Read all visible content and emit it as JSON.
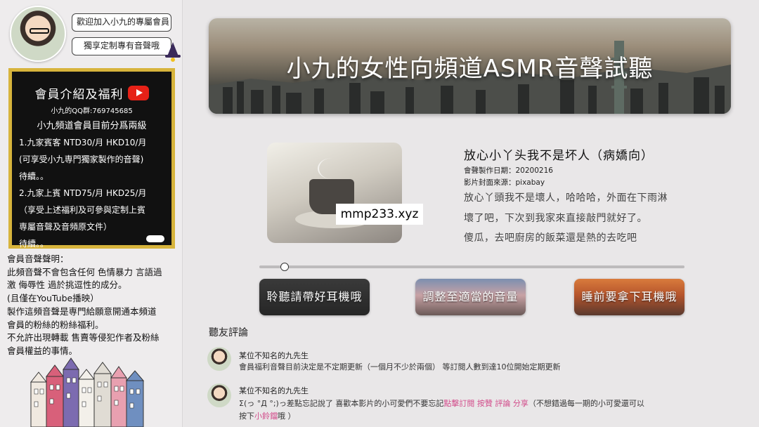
{
  "sidebar": {
    "welcome_label": "歡迎加入小九的專屬會員",
    "custom_label": "獨享定制專有音聲哦",
    "card": {
      "title": "會員介紹及福利",
      "qq": "小九的QQ群:769745685",
      "levels": "小九頻道會員目前分爲兩級",
      "lines": [
        "1.九家賓客 NTD30/月 HKD10/月",
        "(可享受小九専門獨家製作的音聲)",
        "待續。。",
        "2.九家上賓 NTD75/月 HKD25/月",
        "（享受上述福利及可參與定制上賓",
        "専屬音聲及音頻原文件）",
        "待續。。"
      ]
    },
    "notice": [
      "會員音聲聲明：",
      "此頻音聲不會包含任何 色情暴力 言語過",
      "激 侮辱性 過於挑逗性的成分。",
      "(且僅在YouTube播映）",
      "製作這頻音聲是専門給願意開通本頻道",
      "會員的粉絲的粉絲福利。",
      "不允許出現轉載 售賣等侵犯作者及粉絲",
      "會員權益的事情。"
    ]
  },
  "banner": {
    "title": "小九的女性向頻道ASMR音聲試聽"
  },
  "track": {
    "title": "放心小丫头我不是坏人（病嬌向）",
    "date": "會聲製作日期：20200216",
    "source": "影片封面來源：pixabay",
    "desc": [
      "放心丫頭我不是壞人，哈哈哈，外面在下雨淋",
      "壞了吧，下次到我家來直接敲門就好了。",
      "傻瓜，去吧廚房的飯菜還是熱的去吃吧"
    ],
    "progress": 0.06
  },
  "watermark": "mmp233.xyz",
  "buttons": {
    "headphones": "聆聽請帶好耳機哦",
    "volume": "調整至適當的音量",
    "sleep": "睡前要拿下耳機哦"
  },
  "comments": {
    "heading": "聽友評論",
    "items": [
      {
        "name": "某位不知名的九先生",
        "text": "會員福利音聲目前決定是不定期更新（一個月不少於兩個） 等訂閱人數到達10位開始定期更新"
      },
      {
        "name": "某位不知名的九先生",
        "text_prefix": "Σ(っ °Д °;)っ差點忘記說了 喜歡本影片的小可愛們不要忘記",
        "text_highlight": "點擊訂閱 按贊 評論 分享",
        "text_mid": "（不想錯過每一期的小可愛還可以",
        "text_line2_prefix": "按下",
        "text_line2_highlight": "小鈴鐺",
        "text_line2_suffix": "哦 ）"
      }
    ]
  },
  "colors": {
    "card_border": "#d7b43c",
    "card_bg": "#111111",
    "highlight": "#d24b8a",
    "youtube": "#e62117"
  }
}
